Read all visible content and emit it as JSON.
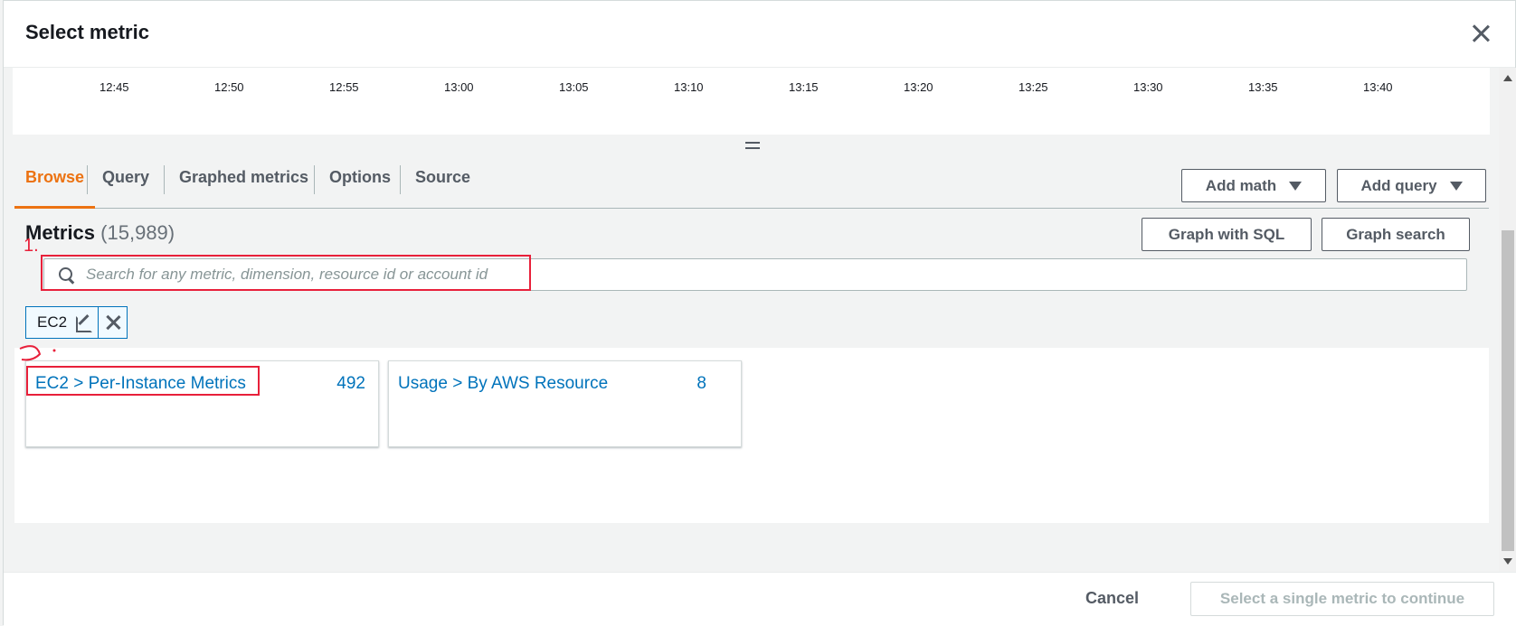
{
  "modal": {
    "title": "Select metric"
  },
  "chart": {
    "x_ticks": [
      "12:45",
      "12:50",
      "12:55",
      "13:00",
      "13:05",
      "13:10",
      "13:15",
      "13:20",
      "13:25",
      "13:30",
      "13:35",
      "13:40"
    ]
  },
  "tabs": [
    {
      "label": "Browse",
      "active": true
    },
    {
      "label": "Query",
      "active": false
    },
    {
      "label": "Graphed metrics",
      "active": false
    },
    {
      "label": "Options",
      "active": false
    },
    {
      "label": "Source",
      "active": false
    }
  ],
  "toolbar": {
    "add_math": "Add math",
    "add_query": "Add query",
    "graph_sql": "Graph with SQL",
    "graph_search": "Graph search"
  },
  "metrics": {
    "title": "Metrics",
    "count": "(15,989)"
  },
  "search": {
    "placeholder": "Search for any metric, dimension, resource id or account id"
  },
  "filter_token": {
    "label": "EC2"
  },
  "results": [
    {
      "label": "EC2 > Per-Instance Metrics",
      "count": "492"
    },
    {
      "label": "Usage > By AWS Resource",
      "count": "8"
    }
  ],
  "footer": {
    "cancel": "Cancel",
    "primary": "Select a single metric to continue"
  },
  "annotations": {
    "step1": "1.",
    "step2": "2.",
    "color": "#e8203a"
  },
  "colors": {
    "accent": "#ec7211",
    "link": "#0073bb"
  }
}
